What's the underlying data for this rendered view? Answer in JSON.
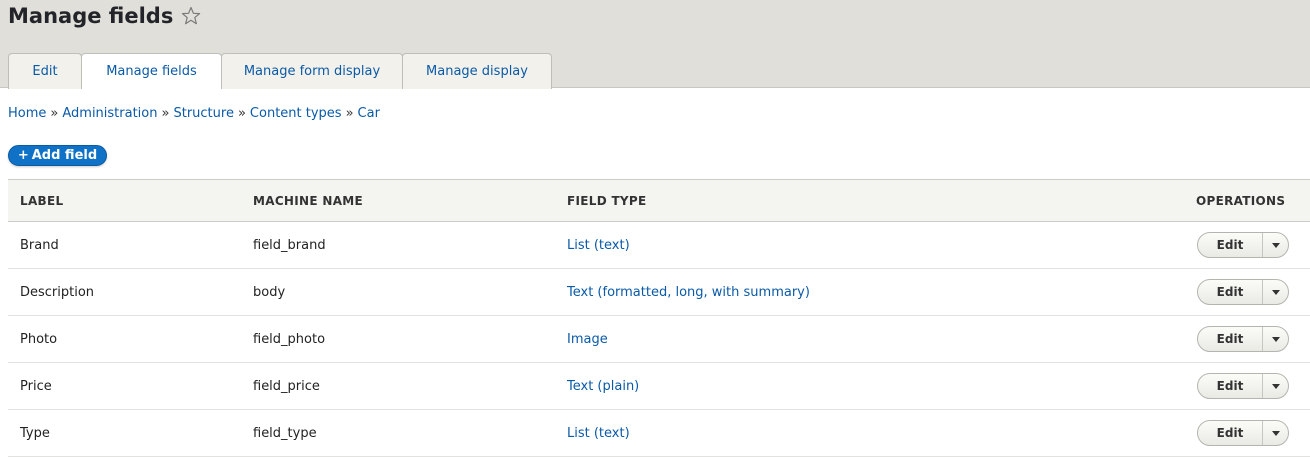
{
  "header": {
    "title": "Manage fields",
    "tabs": [
      {
        "label": "Edit",
        "active": false
      },
      {
        "label": "Manage fields",
        "active": true
      },
      {
        "label": "Manage form display",
        "active": false
      },
      {
        "label": "Manage display",
        "active": false
      }
    ]
  },
  "breadcrumb": [
    "Home",
    "Administration",
    "Structure",
    "Content types",
    "Car"
  ],
  "breadcrumb_separator": "»",
  "add_field": {
    "icon": "+",
    "label": "Add field"
  },
  "table": {
    "columns": [
      "LABEL",
      "MACHINE NAME",
      "FIELD TYPE",
      "OPERATIONS"
    ],
    "rows": [
      {
        "label": "Brand",
        "machine_name": "field_brand",
        "field_type": "List (text)",
        "operation": "Edit"
      },
      {
        "label": "Description",
        "machine_name": "body",
        "field_type": "Text (formatted, long, with summary)",
        "operation": "Edit"
      },
      {
        "label": "Photo",
        "machine_name": "field_photo",
        "field_type": "Image",
        "operation": "Edit"
      },
      {
        "label": "Price",
        "machine_name": "field_price",
        "field_type": "Text (plain)",
        "operation": "Edit"
      },
      {
        "label": "Type",
        "machine_name": "field_type",
        "field_type": "List (text)",
        "operation": "Edit"
      }
    ]
  },
  "colors": {
    "header_bg": "#e0dfd9",
    "link": "#0a5aa8",
    "primary_button": "#1072c6"
  },
  "icons": {
    "favorite": "star-outline-icon",
    "dropdown": "caret-down-icon"
  }
}
